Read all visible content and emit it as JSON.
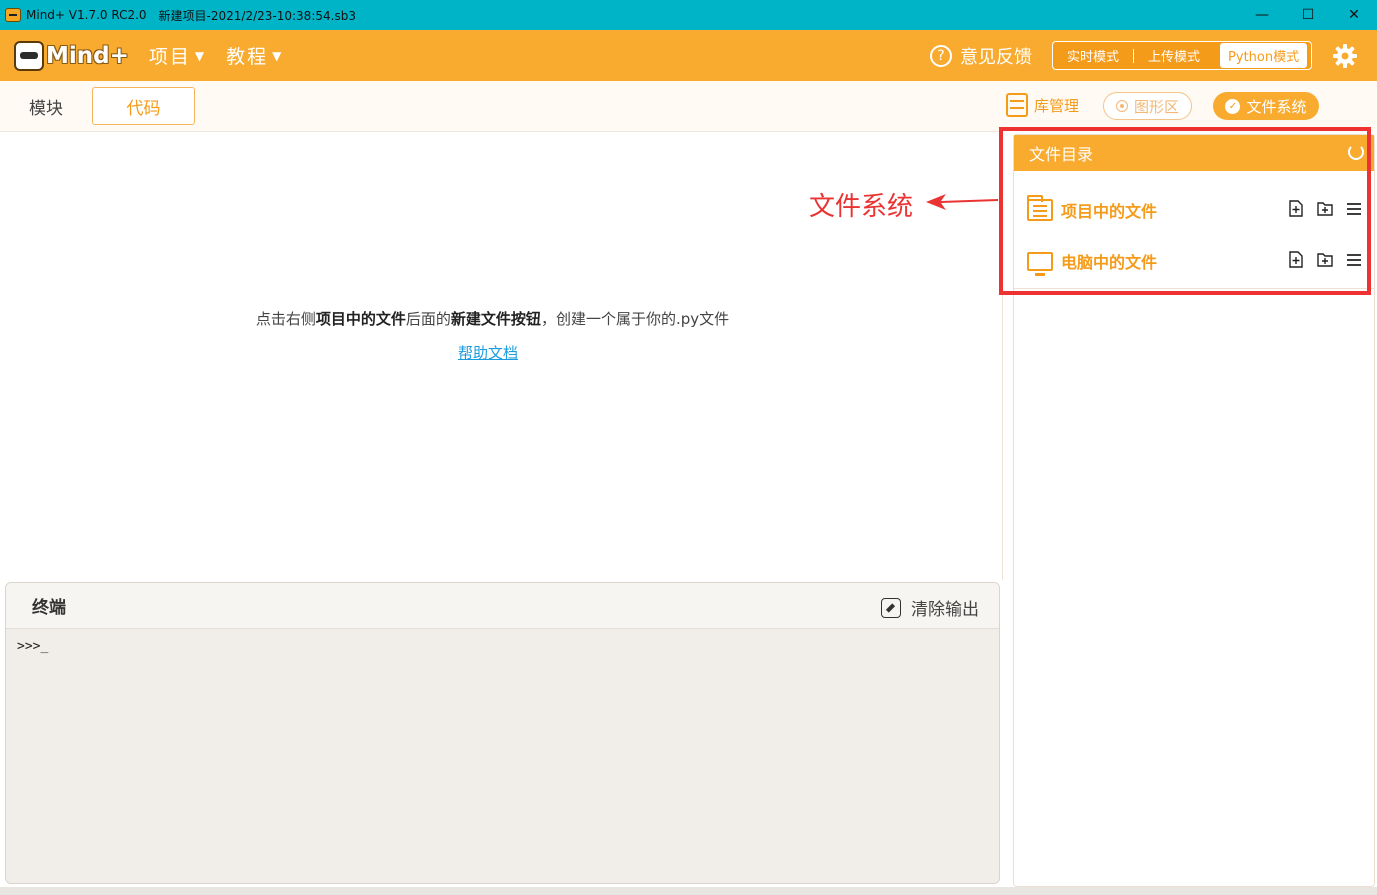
{
  "window": {
    "app_name": "Mind+ V1.7.0 RC2.0",
    "file_name": "新建项目-2021/2/23-10:38:54.sb3",
    "minimize": "—",
    "maximize": "☐",
    "close": "✕"
  },
  "header": {
    "logo_text": "Mind+",
    "menus": [
      {
        "label": "项目"
      },
      {
        "label": "教程"
      }
    ],
    "feedback": "意见反馈",
    "modes": [
      "实时模式",
      "上传模式",
      "Python模式"
    ],
    "active_mode": "Python模式"
  },
  "subbar": {
    "tabs": [
      "模块",
      "代码"
    ],
    "active_tab": "代码",
    "lib_manager": "库管理",
    "graphics": "图形区",
    "file_system": "文件系统"
  },
  "editor": {
    "hint_prefix": "点击右侧",
    "hint_bold1": "项目中的文件",
    "hint_mid": "后面的",
    "hint_bold2": "新建文件按钮",
    "hint_suffix": "，创建一个属于你的.py文件",
    "help_link": "帮助文档"
  },
  "annotation": {
    "text": "文件系统",
    "color": "#ea3434"
  },
  "terminal": {
    "title": "终端",
    "clear": "清除输出",
    "prompt": ">>>_"
  },
  "file_panel": {
    "title": "文件目录",
    "rows": [
      {
        "label": "项目中的文件",
        "icon": "folder-list-icon"
      },
      {
        "label": "电脑中的文件",
        "icon": "monitor-icon"
      }
    ]
  },
  "colors": {
    "accent": "#f8ab2f",
    "titlebar": "#00b4c8",
    "link": "#1a9de0",
    "highlight": "#ee3131"
  }
}
